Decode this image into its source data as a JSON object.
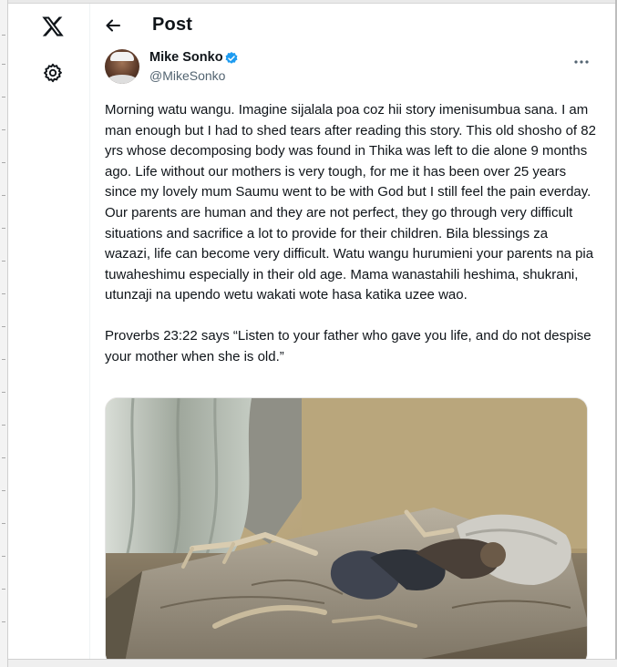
{
  "nav": {
    "logo_icon": "x-logo-icon",
    "settings_icon": "gear-icon"
  },
  "header": {
    "back_icon": "arrow-left-icon",
    "title": "Post"
  },
  "tweet": {
    "author": {
      "display_name": "Mike Sonko",
      "handle": "@MikeSonko",
      "verified": true,
      "verified_color": "#1d9bf0"
    },
    "more_icon": "more-horizontal-icon",
    "paragraphs": [
      "Morning watu wangu. Imagine sijalala poa coz hii story imenisumbua sana. I am man enough but I had to shed tears after reading this story. This old shosho of 82 yrs whose decomposing body was found in Thika was left to die alone 9 months ago. Life without our mothers is very tough, for me it has been over 25 years since my lovely mum Saumu went to be with God but I still feel the pain everday. Our parents are human and they are not perfect, they go through very difficult situations and sacrifice a lot to provide for their children. Bila blessings za wazazi, life can become very difficult. Watu wangu hurumieni your parents na pia tuwaheshimu especially in their old age. Mama wanastahili heshima, shukrani, utunzaji na upendo wetu wakati wote hasa katika uzee wao.",
      "Proverbs 23:22 says “Listen to your father who gave you life, and do not despise your mother when she is old.”"
    ]
  },
  "colors": {
    "text_primary": "#0f1419",
    "text_secondary": "#536471",
    "accent": "#1d9bf0"
  }
}
